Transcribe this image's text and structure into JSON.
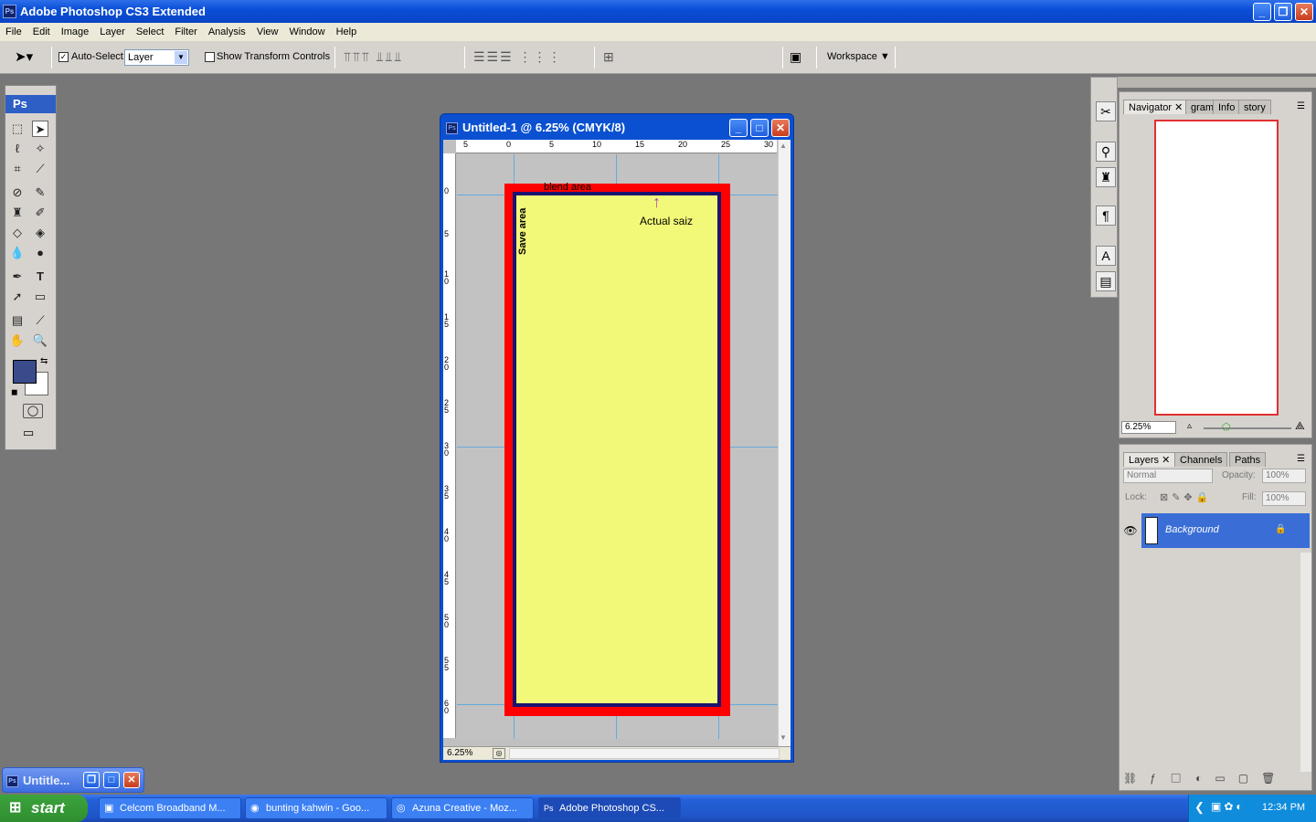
{
  "window": {
    "title": "Adobe Photoshop CS3 Extended",
    "icon": "Ps"
  },
  "menubar": [
    "File",
    "Edit",
    "Image",
    "Layer",
    "Select",
    "Filter",
    "Analysis",
    "View",
    "Window",
    "Help"
  ],
  "options": {
    "auto_select_label": "Auto-Select:",
    "auto_select_value": "Layer",
    "show_transform_label": "Show Transform Controls",
    "workspace_label": "Workspace"
  },
  "tools": {
    "header": "Ps",
    "foreground_color": "#3a4b8c",
    "background_color": "#ffffff"
  },
  "document": {
    "title": "Untitled-1 @ 6.25% (CMYK/8)",
    "zoom": "6.25%",
    "ruler_top": [
      "5",
      "0",
      "5",
      "10",
      "15",
      "20",
      "25",
      "30"
    ],
    "ruler_left": [
      "0",
      "5",
      "1 0",
      "1 5",
      "2 0",
      "2 5",
      "3 0",
      "3 5",
      "4 0",
      "4 5",
      "5 0",
      "5 5",
      "6 0"
    ],
    "annotations": {
      "blend": "blend area",
      "actual": "Actual saiz",
      "save": "Save area"
    },
    "colors": {
      "bleed": "#ff0000",
      "safe_border": "#1a1470",
      "fill": "#f2f878",
      "arrow": "#b040c0"
    }
  },
  "navigator": {
    "tabs": [
      "Navigator",
      "gram",
      "Info",
      "story"
    ],
    "zoom": "6.25%"
  },
  "layers": {
    "tabs": [
      "Layers",
      "Channels",
      "Paths"
    ],
    "blend_mode": "Normal",
    "opacity_label": "Opacity:",
    "opacity": "100%",
    "lock_label": "Lock:",
    "fill_label": "Fill:",
    "fill": "100%",
    "layer_name": "Background"
  },
  "minidoc": {
    "title": "Untitle..."
  },
  "taskbar": {
    "start": "start",
    "tasks": [
      "Celcom Broadband M...",
      "bunting kahwin - Goo...",
      "Azuna Creative - Moz...",
      "Adobe Photoshop CS..."
    ],
    "clock": "12:34 PM"
  }
}
